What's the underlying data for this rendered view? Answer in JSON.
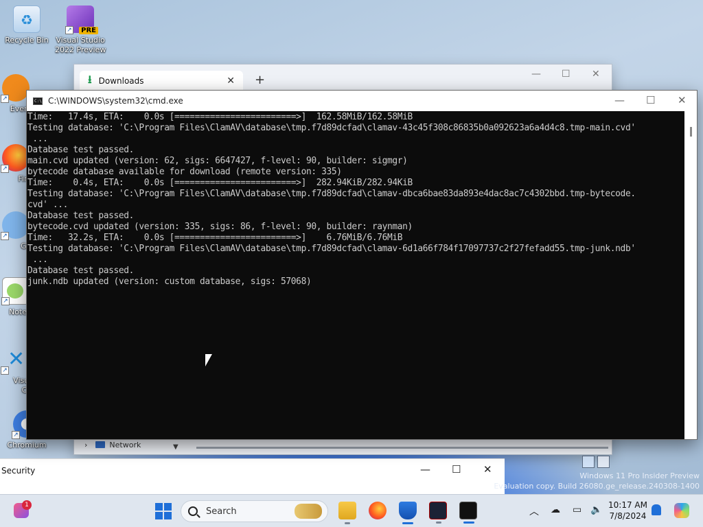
{
  "desktop": {
    "icons": [
      {
        "label": "Recycle Bin"
      },
      {
        "label_line1": "Visual Studio",
        "label_line2": "2022 Preview",
        "badge": "PRE"
      },
      {
        "label": "Every"
      },
      {
        "label": "Fire"
      },
      {
        "label": "Git"
      },
      {
        "label": "Notep"
      },
      {
        "label_line1": "Visual",
        "label_line2": "Co"
      },
      {
        "label": "Chromium"
      }
    ]
  },
  "downloads_window": {
    "tab_title": "Downloads",
    "nav_item": "Network"
  },
  "security_window": {
    "title": "Security"
  },
  "cmd_window": {
    "title": "C:\\WINDOWS\\system32\\cmd.exe",
    "lines": [
      "Time:   17.4s, ETA:    0.0s [========================>]  162.58MiB/162.58MiB",
      "Testing database: 'C:\\Program Files\\ClamAV\\database\\tmp.f7d89dcfad\\clamav-43c45f308c86835b0a092623a6a4d4c8.tmp-main.cvd'",
      " ...",
      "Database test passed.",
      "main.cvd updated (version: 62, sigs: 6647427, f-level: 90, builder: sigmgr)",
      "bytecode database available for download (remote version: 335)",
      "Time:    0.4s, ETA:    0.0s [========================>]  282.94KiB/282.94KiB",
      "Testing database: 'C:\\Program Files\\ClamAV\\database\\tmp.f7d89dcfad\\clamav-dbca6bae83da893e4dac8ac7c4302bbd.tmp-bytecode.",
      "cvd' ...",
      "Database test passed.",
      "bytecode.cvd updated (version: 335, sigs: 86, f-level: 90, builder: raynman)",
      "Time:   32.2s, ETA:    0.0s [========================>]    6.76MiB/6.76MiB",
      "Testing database: 'C:\\Program Files\\ClamAV\\database\\tmp.f7d89dcfad\\clamav-6d1a66f784f17097737c2f27fefadd55.tmp-junk.ndb'",
      " ...",
      "Database test passed.",
      "junk.ndb updated (version: custom database, sigs: 57068)"
    ]
  },
  "watermark": {
    "line1": "Windows 11 Pro Insider Preview",
    "line2": "Evaluation copy. Build 26080.ge_release.240308-1400"
  },
  "taskbar": {
    "notification_count": "1",
    "search_placeholder": "Search",
    "clock_time": "10:17 AM",
    "clock_date": "7/8/2024"
  },
  "colors": {
    "cmd_background": "#0c0c0c",
    "cmd_text": "#cccccc",
    "accent": "#1f6fd8"
  }
}
